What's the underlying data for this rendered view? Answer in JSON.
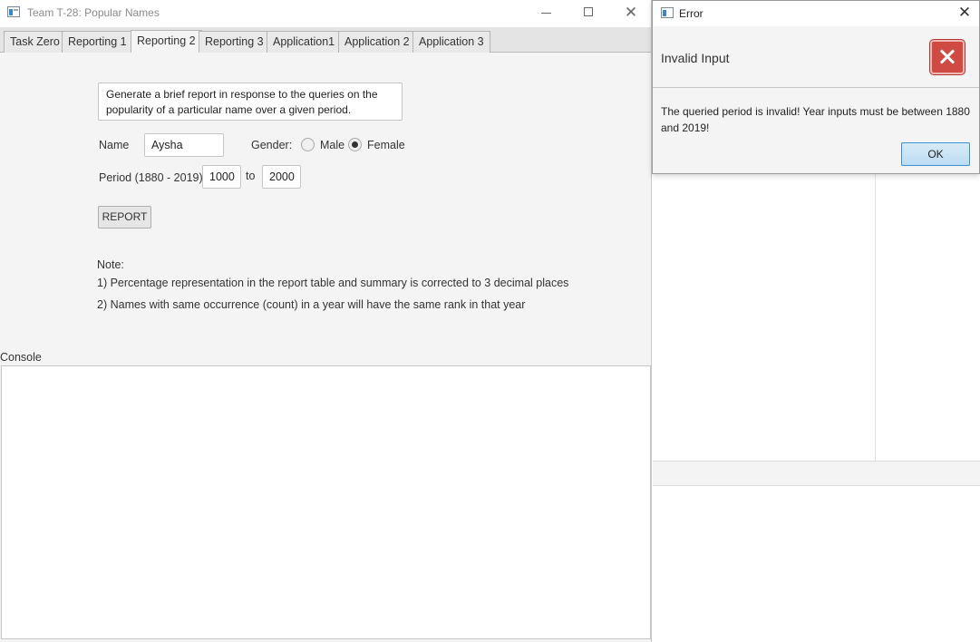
{
  "main_window": {
    "title": "Team T-28: Popular Names",
    "tabs": [
      {
        "label": "Task Zero"
      },
      {
        "label": "Reporting 1"
      },
      {
        "label": "Reporting 2"
      },
      {
        "label": "Reporting 3"
      },
      {
        "label": "Application1"
      },
      {
        "label": "Application 2"
      },
      {
        "label": "Application 3"
      }
    ],
    "active_tab": "Reporting 2"
  },
  "reporting2": {
    "description": "Generate a brief report in response to the queries on the popularity of a particular name over a given period.",
    "name_label": "Name",
    "name_value": "Aysha",
    "gender_label": "Gender:",
    "gender_male": "Male",
    "gender_female": "Female",
    "selected_gender": "Female",
    "period_label": "Period (1880 - 2019):",
    "period_from": "1000",
    "to_label": "to",
    "period_to": "2000",
    "report_button": "REPORT",
    "note_title": "Note:",
    "note_1": "1) Percentage representation in the report table and summary is corrected to 3 decimal places",
    "note_2": "2) Names with same occurrence (count) in a year will have the same rank in that year",
    "console_label": "Console"
  },
  "error_dialog": {
    "title": "Error",
    "header": "Invalid Input",
    "message": "The queried period is invalid! Year inputs must be between 1880 and 2019!",
    "ok_button": "OK"
  },
  "icons": {
    "app_icon": "java-window-icon",
    "error_icon": "error-x-icon"
  },
  "colors": {
    "error_icon": "#d04a44",
    "ok_button_border": "#3c8fd0"
  }
}
